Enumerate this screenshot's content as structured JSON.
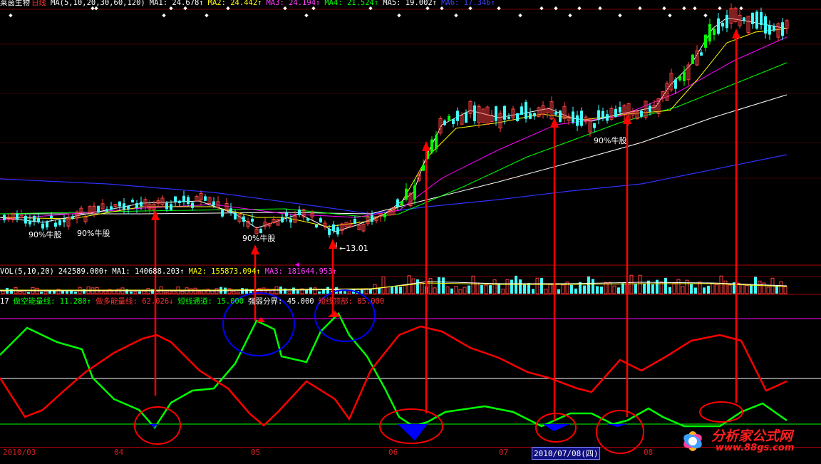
{
  "header_price": {
    "name": "莱茵生物",
    "period": "日线",
    "ma_label": "MA(5,10,20,30,60,120)",
    "ma1": "MA1: 24.678↑",
    "ma2": "MA2: 24.442↑",
    "ma3": "MA3: 24.194↑",
    "ma4": "MA4: 21.524↑",
    "ma5": "MA5: 19.002↑",
    "ma6": "MA6: 17.346↑"
  },
  "header_vol": {
    "label": "VOL(5,10,20)",
    "vol": "242589.000↑",
    "ma1": "MA1: 140688.203↑",
    "ma2": "MA2: 155873.094↑",
    "ma3": "MA3: 181644.953↑"
  },
  "header_ind": {
    "id": "17",
    "short_energy": "做空能量线: 11.280↑",
    "long_energy": "做多能量线: 62.026↓",
    "channel": "短线通道: 15.000",
    "divide": "强弱分界: 45.000",
    "top": "短线顶部: 85.000"
  },
  "annotations": {
    "bull_stock_label": "90%牛股",
    "low_price": "13.01"
  },
  "date_axis": [
    "2010/03",
    "04",
    "05",
    "06",
    "07",
    "08"
  ],
  "selected_date": "2010/07/08(四)",
  "watermark": {
    "name": "分析家公式网",
    "url": "www.88gs.com"
  },
  "colors": {
    "up": "#ff4040",
    "down": "#40ffff",
    "strong": "#00ff00",
    "ma1": "#ffffff",
    "ma2": "#ffff00",
    "ma3": "#ff00ff",
    "ma4": "#00ff00",
    "ma5": "#ffffff",
    "ma6": "#3030ff",
    "short_line": "#00ff00",
    "long_line": "#ff0000",
    "annotation": "#ff0000",
    "circle": "#0000ff"
  },
  "chart_data": [
    {
      "type": "candlestick",
      "title": "莱茵生物 日线",
      "series": [
        {
          "name": "MA1",
          "value": 24.678
        },
        {
          "name": "MA2",
          "value": 24.442
        },
        {
          "name": "MA3",
          "value": 24.194
        },
        {
          "name": "MA4",
          "value": 21.524
        },
        {
          "name": "MA5",
          "value": 19.002
        },
        {
          "name": "MA6",
          "value": 17.346
        }
      ],
      "annotations": [
        "90%牛股",
        "13.01"
      ]
    },
    {
      "type": "bar",
      "title": "VOL(5,10,20)",
      "series": [
        {
          "name": "VOL",
          "value": 242589.0
        },
        {
          "name": "MA1",
          "value": 140688.203
        },
        {
          "name": "MA2",
          "value": 155873.094
        },
        {
          "name": "MA3",
          "value": 181644.953
        }
      ]
    },
    {
      "type": "line",
      "series": [
        {
          "name": "做空能量线",
          "value": 11.28
        },
        {
          "name": "做多能量线",
          "value": 62.026
        }
      ],
      "levels": [
        {
          "name": "短线通道",
          "value": 15
        },
        {
          "name": "强弱分界",
          "value": 45
        },
        {
          "name": "短线顶部",
          "value": 85
        }
      ]
    }
  ]
}
